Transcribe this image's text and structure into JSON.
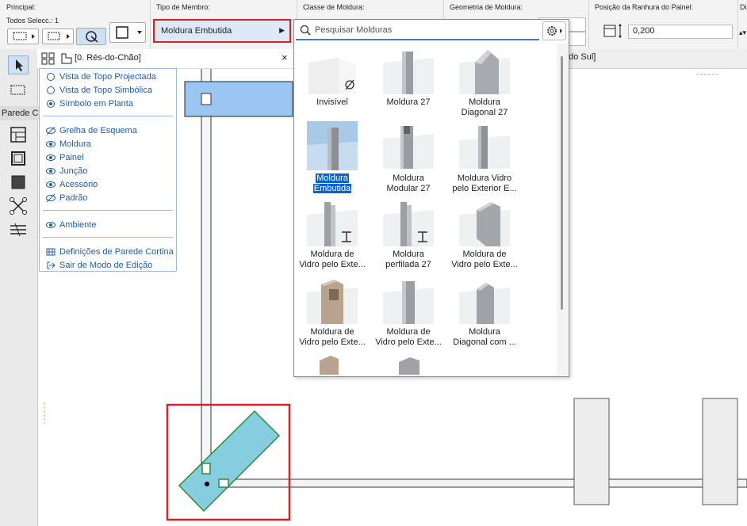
{
  "infobox": {
    "principal": {
      "title": "Principal:",
      "selection": "Todos Selecc.: 1"
    },
    "member_type": {
      "title": "Tipo de Membro:",
      "value": "Moldura Embutida"
    },
    "frame_class": {
      "title": "Classe de Moldura:"
    },
    "frame_geometry": {
      "title": "Geometria de Moldura:"
    },
    "panel_groove": {
      "title": "Posição da Ranhura do Painel:",
      "value": "0,200"
    },
    "cut_title": "Di"
  },
  "toolbox": {
    "section_label": "Parede C"
  },
  "tabbar": {
    "right_tab": "ado Sul]"
  },
  "edit_panel": {
    "story": "[0. Rés-do-Chão]",
    "close": "×",
    "views": [
      {
        "label": "Vista de Topo Projectada",
        "selected": false
      },
      {
        "label": "Vista de Topo Simbólica",
        "selected": false
      },
      {
        "label": "Símbolo em Planta",
        "selected": true
      }
    ],
    "layers": [
      {
        "label": "Grelha de Esquema",
        "visible": false
      },
      {
        "label": "Moldura",
        "visible": true
      },
      {
        "label": "Painel",
        "visible": true
      },
      {
        "label": "Junção",
        "visible": true
      },
      {
        "label": "Acessório",
        "visible": true
      },
      {
        "label": "Padrão",
        "visible": false
      }
    ],
    "ambient": {
      "label": "Ambiente",
      "visible": true
    },
    "actions": [
      {
        "label": "Definições de Parede Cortina",
        "icon": "curtain-wall-settings-icon"
      },
      {
        "label": "Sair de Modo de Edição",
        "icon": "exit-icon"
      }
    ]
  },
  "gallery": {
    "search_placeholder": "Pesquisar Molduras",
    "items": [
      {
        "line1": "Invisível",
        "line2": "",
        "selected": false
      },
      {
        "line1": "Moldura 27",
        "line2": "",
        "selected": false
      },
      {
        "line1": "Moldura",
        "line2": "Diagonal 27",
        "selected": false
      },
      {
        "line1": "Moldura",
        "line2": "Embutida",
        "selected": true
      },
      {
        "line1": "Moldura",
        "line2": "Modular 27",
        "selected": false
      },
      {
        "line1": "Moldura Vidro",
        "line2": "pelo Exterior E...",
        "selected": false
      },
      {
        "line1": "Moldura de",
        "line2": "Vidro pelo Exte...",
        "selected": false
      },
      {
        "line1": "Moldura",
        "line2": "perfilada 27",
        "selected": false
      },
      {
        "line1": "Moldura de",
        "line2": "Vidro pelo Exte...",
        "selected": false
      },
      {
        "line1": "Moldura de",
        "line2": "Vidro pelo Exte...",
        "selected": false
      },
      {
        "line1": "Moldura de",
        "line2": "Vidro pelo Exte...",
        "selected": false
      },
      {
        "line1": "Moldura",
        "line2": "Diagonal com ...",
        "selected": false
      }
    ]
  },
  "colors": {
    "highlight_red": "#e02020",
    "selection_blue": "#0a64c8",
    "frame_fill": "#86cde0"
  }
}
